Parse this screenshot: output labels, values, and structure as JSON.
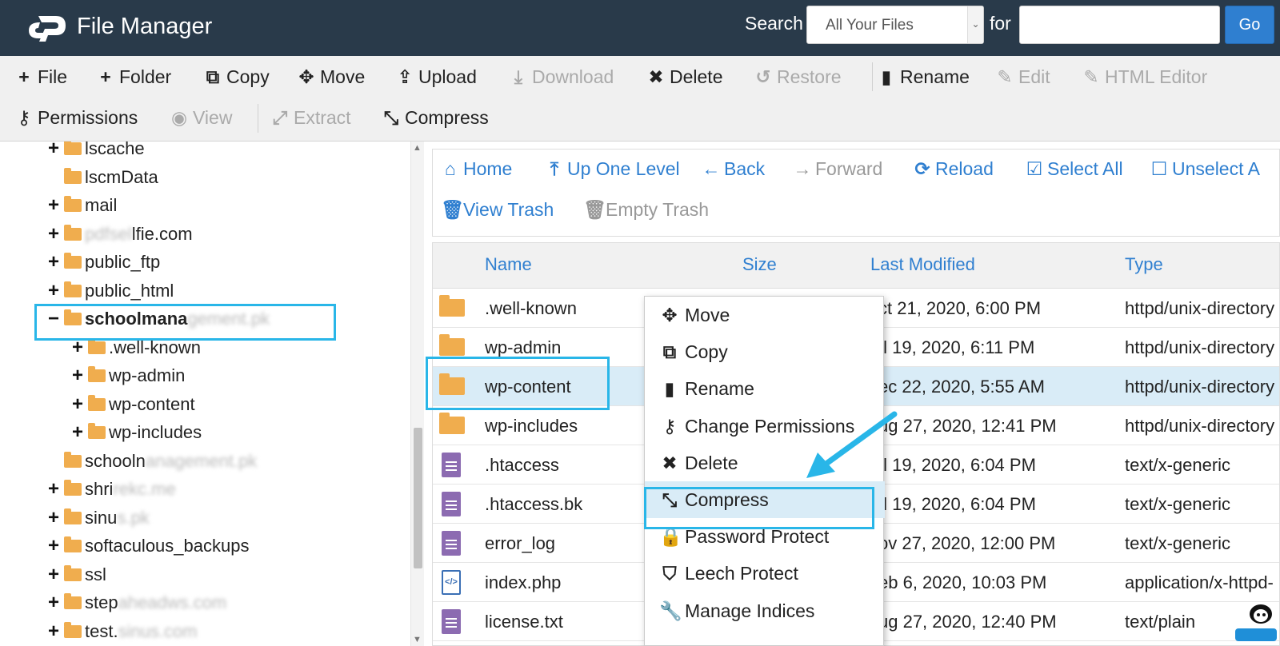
{
  "header": {
    "app_title": "File Manager",
    "search_label": "Search",
    "search_scope": "All Your Files",
    "for_label": "for",
    "search_value": "",
    "go_label": "Go"
  },
  "toolbar": {
    "row1": [
      {
        "name": "file-button",
        "icon": "plus-icon",
        "glyph": "+",
        "label": "File",
        "disabled": false
      },
      {
        "name": "folder-button",
        "icon": "plus-icon",
        "glyph": "+",
        "label": "Folder",
        "disabled": false
      },
      {
        "name": "copy-button",
        "icon": "copy-icon",
        "glyph": "⧉",
        "label": "Copy",
        "disabled": false
      },
      {
        "name": "move-button",
        "icon": "move-icon",
        "glyph": "✥",
        "label": "Move",
        "disabled": false
      },
      {
        "name": "upload-button",
        "icon": "upload-icon",
        "glyph": "⇪",
        "label": "Upload",
        "disabled": false
      },
      {
        "name": "download-button",
        "icon": "download-icon",
        "glyph": "⤓",
        "label": "Download",
        "disabled": true
      },
      {
        "name": "delete-button",
        "icon": "close-icon",
        "glyph": "✖",
        "label": "Delete",
        "disabled": false
      },
      {
        "name": "restore-button",
        "icon": "undo-icon",
        "glyph": "↺",
        "label": "Restore",
        "disabled": true
      },
      {
        "name": "rename-button",
        "icon": "file-icon",
        "glyph": "▮",
        "label": "Rename",
        "disabled": false
      },
      {
        "name": "edit-button",
        "icon": "pencil-icon",
        "glyph": "✎",
        "label": "Edit",
        "disabled": true
      },
      {
        "name": "html-editor-button",
        "icon": "edit-box-icon",
        "glyph": "✎",
        "label": "HTML Editor",
        "disabled": true
      }
    ],
    "row2": [
      {
        "name": "permissions-button",
        "icon": "key-icon",
        "glyph": "⚷",
        "label": "Permissions",
        "disabled": false
      },
      {
        "name": "view-button",
        "icon": "eye-icon",
        "glyph": "◉",
        "label": "View",
        "disabled": true
      },
      {
        "name": "extract-button",
        "icon": "expand-icon",
        "glyph": "⤢",
        "label": "Extract",
        "disabled": true
      },
      {
        "name": "compress-button",
        "icon": "compress-icon",
        "glyph": "⤡",
        "label": "Compress",
        "disabled": false
      }
    ]
  },
  "tree": [
    {
      "expander": "+",
      "label": "lscache",
      "blurred": ""
    },
    {
      "expander": "",
      "label": "lscmData",
      "blurred": ""
    },
    {
      "expander": "+",
      "label": "mail",
      "blurred": ""
    },
    {
      "expander": "+",
      "label": "lfie.com",
      "blurred": "pdfsel"
    },
    {
      "expander": "+",
      "label": "public_ftp",
      "blurred": ""
    },
    {
      "expander": "+",
      "label": "public_html",
      "blurred": ""
    },
    {
      "expander": "−",
      "label": "schoolmana",
      "blurred": "gement.pk",
      "bold": true,
      "open": true
    },
    {
      "expander": "+",
      "label": ".well-known",
      "blurred": "",
      "child": true
    },
    {
      "expander": "+",
      "label": "wp-admin",
      "blurred": "",
      "child": true
    },
    {
      "expander": "+",
      "label": "wp-content",
      "blurred": "",
      "child": true
    },
    {
      "expander": "+",
      "label": "wp-includes",
      "blurred": "",
      "child": true
    },
    {
      "expander": "",
      "label": "schooln",
      "blurred": "anagement.pk"
    },
    {
      "expander": "+",
      "label": "shri",
      "blurred": "rekc.me"
    },
    {
      "expander": "+",
      "label": "sinu",
      "blurred": "s.pk"
    },
    {
      "expander": "+",
      "label": "softaculous_backups",
      "blurred": ""
    },
    {
      "expander": "+",
      "label": "ssl",
      "blurred": ""
    },
    {
      "expander": "+",
      "label": "step",
      "blurred": "aheadws.com"
    },
    {
      "expander": "+",
      "label": "test.",
      "blurred": "sinus.com"
    }
  ],
  "nav": {
    "row1": [
      {
        "name": "home-link",
        "icon": "home-icon",
        "glyph": "⌂",
        "label": "Home",
        "disabled": false
      },
      {
        "name": "up-one-level-link",
        "icon": "arrow-up-icon",
        "glyph": "⤒",
        "label": "Up One Level",
        "disabled": false
      },
      {
        "name": "back-link",
        "icon": "arrow-left-icon",
        "glyph": "←",
        "label": "Back",
        "disabled": false
      },
      {
        "name": "forward-link",
        "icon": "arrow-right-icon",
        "glyph": "→",
        "label": "Forward",
        "disabled": true
      },
      {
        "name": "reload-link",
        "icon": "reload-icon",
        "glyph": "⟳",
        "label": "Reload",
        "disabled": false
      },
      {
        "name": "select-all-link",
        "icon": "checkbox-checked-icon",
        "glyph": "☑",
        "label": "Select All",
        "disabled": false
      },
      {
        "name": "unselect-all-link",
        "icon": "checkbox-empty-icon",
        "glyph": "☐",
        "label": "Unselect A",
        "disabled": false
      }
    ],
    "row2": [
      {
        "name": "view-trash-link",
        "icon": "trash-icon",
        "glyph": "🗑",
        "label": "View Trash",
        "disabled": false
      },
      {
        "name": "empty-trash-link",
        "icon": "trash-icon",
        "glyph": "🗑",
        "label": "Empty Trash",
        "disabled": true
      }
    ]
  },
  "table": {
    "headers": {
      "name": "Name",
      "size": "Size",
      "modified": "Last Modified",
      "type": "Type"
    },
    "rows": [
      {
        "kind": "folder",
        "name": ".well-known",
        "size": "",
        "modified": "ct 21, 2020, 6:00 PM",
        "type": "httpd/unix-directory"
      },
      {
        "kind": "folder",
        "name": "wp-admin",
        "size": "",
        "modified": "ıl 19, 2020, 6:11 PM",
        "type": "httpd/unix-directory"
      },
      {
        "kind": "folder",
        "name": "wp-content",
        "size": "",
        "modified": "ec 22, 2020, 5:55 AM",
        "type": "httpd/unix-directory",
        "selected": true
      },
      {
        "kind": "folder",
        "name": "wp-includes",
        "size": "",
        "modified": "ug 27, 2020, 12:41 PM",
        "type": "httpd/unix-directory"
      },
      {
        "kind": "file",
        "name": ".htaccess",
        "size": "",
        "modified": "ıl 19, 2020, 6:04 PM",
        "type": "text/x-generic"
      },
      {
        "kind": "file",
        "name": ".htaccess.bk",
        "size": "",
        "modified": "ıl 19, 2020, 6:04 PM",
        "type": "text/x-generic"
      },
      {
        "kind": "file",
        "name": "error_log",
        "size": "",
        "modified": "ov 27, 2020, 12:00 PM",
        "type": "text/x-generic"
      },
      {
        "kind": "code",
        "name": "index.php",
        "size": "",
        "modified": "eb 6, 2020, 10:03 PM",
        "type": "application/x-httpd-"
      },
      {
        "kind": "file",
        "name": "license.txt",
        "size": "",
        "modified": "ug 27, 2020, 12:40 PM",
        "type": "text/plain"
      }
    ]
  },
  "context_menu": [
    {
      "name": "ctx-move",
      "icon": "move-icon",
      "glyph": "✥",
      "label": "Move"
    },
    {
      "name": "ctx-copy",
      "icon": "copy-icon",
      "glyph": "⧉",
      "label": "Copy"
    },
    {
      "name": "ctx-rename",
      "icon": "file-icon",
      "glyph": "▮",
      "label": "Rename"
    },
    {
      "name": "ctx-change-permissions",
      "icon": "key-icon",
      "glyph": "⚷",
      "label": "Change Permissions"
    },
    {
      "name": "ctx-delete",
      "icon": "close-icon",
      "glyph": "✖",
      "label": "Delete"
    },
    {
      "name": "ctx-compress",
      "icon": "compress-icon",
      "glyph": "⤡",
      "label": "Compress",
      "active": true
    },
    {
      "name": "ctx-password-protect",
      "icon": "lock-icon",
      "glyph": "🔒",
      "label": "Password Protect"
    },
    {
      "name": "ctx-leech-protect",
      "icon": "shield-icon",
      "glyph": "⛉",
      "label": "Leech Protect"
    },
    {
      "name": "ctx-manage-indices",
      "icon": "wrench-icon",
      "glyph": "🔧",
      "label": "Manage Indices"
    }
  ],
  "colors": {
    "header_bg": "#293a4a",
    "accent": "#2f7fd0",
    "highlight_border": "#29b6e8",
    "folder": "#f0ad4e",
    "selected_row": "#d9ecf7"
  }
}
